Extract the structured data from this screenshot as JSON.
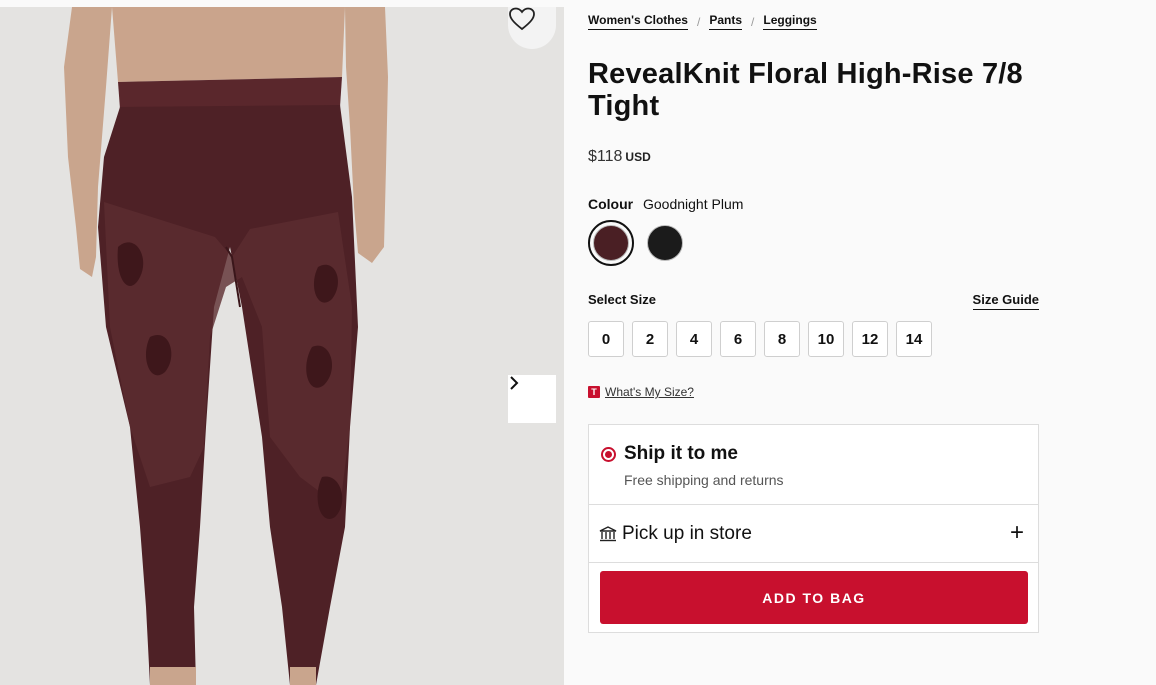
{
  "breadcrumb": [
    "Women's Clothes",
    "Pants",
    "Leggings"
  ],
  "product": {
    "title": "RevealKnit Floral High-Rise 7/8 Tight",
    "price": "$118",
    "currency": "USD"
  },
  "colour": {
    "label": "Colour",
    "selected_name": "Goodnight Plum",
    "swatches": [
      {
        "name": "Goodnight Plum",
        "hex": "#4a1f24",
        "selected": true
      },
      {
        "name": "Black",
        "hex": "#1b1b1b",
        "selected": false
      }
    ]
  },
  "size": {
    "label": "Select Size",
    "guide_label": "Size Guide",
    "options": [
      "0",
      "2",
      "4",
      "6",
      "8",
      "10",
      "12",
      "14"
    ],
    "whats_my_size": "What's My Size?"
  },
  "delivery": {
    "ship_title": "Ship it to me",
    "ship_sub": "Free shipping and returns",
    "pickup_label": "Pick up in store",
    "pickup_toggle": "+"
  },
  "cta": {
    "add_to_bag": "ADD TO BAG"
  },
  "colors": {
    "accent": "#c8102e",
    "legging": "#4e2126"
  },
  "icons": {
    "wishlist": "heart-icon",
    "next": "chevron-right-icon",
    "store": "store-icon",
    "expand": "plus-icon"
  }
}
